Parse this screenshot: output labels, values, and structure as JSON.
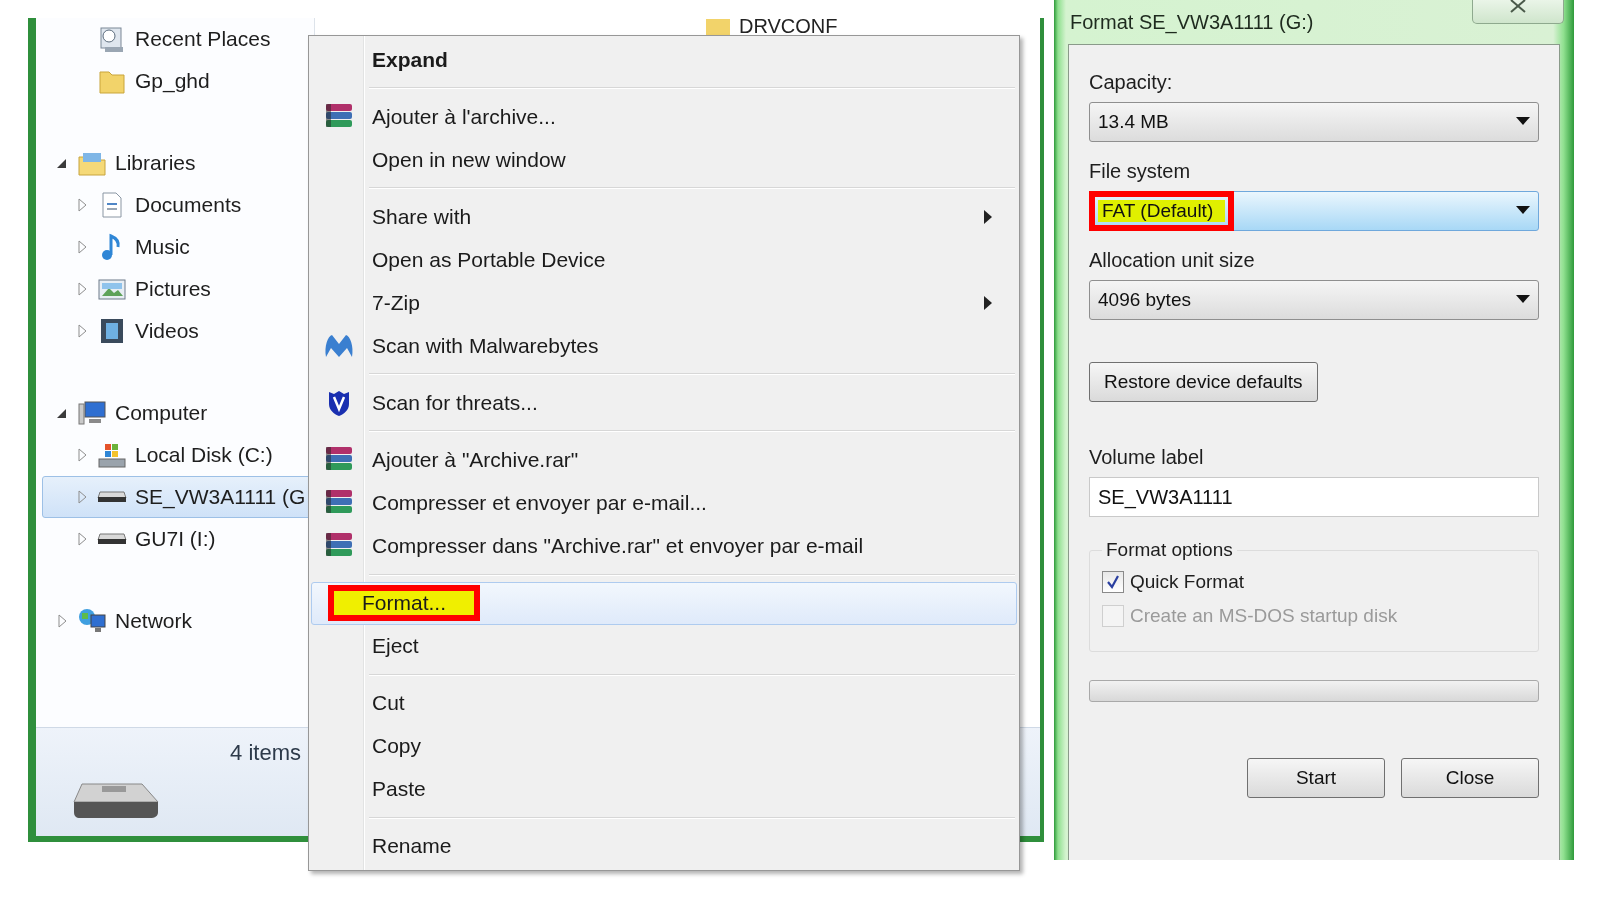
{
  "explorer": {
    "favorites": [
      {
        "label": "Recent Places",
        "kind": "recent"
      },
      {
        "label": "Gp_ghd",
        "kind": "folder"
      }
    ],
    "tree": [
      {
        "label": "Libraries",
        "kind": "library",
        "expanded": true,
        "selected": false,
        "children": [
          {
            "label": "Documents",
            "kind": "documents",
            "expanded": false,
            "selected": false
          },
          {
            "label": "Music",
            "kind": "music",
            "expanded": false,
            "selected": false
          },
          {
            "label": "Pictures",
            "kind": "pictures",
            "expanded": false,
            "selected": false
          },
          {
            "label": "Videos",
            "kind": "videos",
            "expanded": false,
            "selected": false
          }
        ]
      },
      {
        "label": "Computer",
        "kind": "computer",
        "expanded": true,
        "selected": false,
        "children": [
          {
            "label": "Local Disk (C:)",
            "kind": "disk",
            "expanded": false,
            "selected": false
          },
          {
            "label": "SE_VW3A1111 (G",
            "kind": "drive",
            "expanded": false,
            "selected": true
          },
          {
            "label": "GU7I (I:)",
            "kind": "drive",
            "expanded": false,
            "selected": false
          }
        ]
      },
      {
        "label": "Network",
        "kind": "network",
        "expanded": false,
        "selected": false
      }
    ],
    "content_item": "DRVCONF",
    "status": "4 items"
  },
  "context_menu": {
    "groups": [
      [
        {
          "label": "Expand",
          "kind": "plain",
          "bold": true,
          "submenu": false,
          "selected": false,
          "highlighted": false
        }
      ],
      [
        {
          "label": "Ajouter à l'archive...",
          "kind": "archive",
          "bold": false,
          "submenu": false,
          "selected": false,
          "highlighted": false
        },
        {
          "label": "Open in new window",
          "kind": "plain",
          "bold": false,
          "submenu": false,
          "selected": false,
          "highlighted": false
        }
      ],
      [
        {
          "label": "Share with",
          "kind": "plain",
          "bold": false,
          "submenu": true,
          "selected": false,
          "highlighted": false
        },
        {
          "label": "Open as Portable Device",
          "kind": "plain",
          "bold": false,
          "submenu": false,
          "selected": false,
          "highlighted": false
        },
        {
          "label": "7-Zip",
          "kind": "plain",
          "bold": false,
          "submenu": true,
          "selected": false,
          "highlighted": false
        },
        {
          "label": "Scan with Malwarebytes",
          "kind": "malware-scan",
          "bold": false,
          "submenu": false,
          "selected": false,
          "highlighted": false
        }
      ],
      [
        {
          "label": "Scan for threats...",
          "kind": "virus-scan",
          "bold": false,
          "submenu": false,
          "selected": false,
          "highlighted": false
        }
      ],
      [
        {
          "label": "Ajouter à \"Archive.rar\"",
          "kind": "archive",
          "bold": false,
          "submenu": false,
          "selected": false,
          "highlighted": false
        },
        {
          "label": "Compresser et envoyer par e-mail...",
          "kind": "archive",
          "bold": false,
          "submenu": false,
          "selected": false,
          "highlighted": false
        },
        {
          "label": "Compresser dans \"Archive.rar\" et envoyer par e-mail",
          "kind": "archive",
          "bold": false,
          "submenu": false,
          "selected": false,
          "highlighted": false
        }
      ],
      [
        {
          "label": "Format...",
          "kind": "plain",
          "bold": false,
          "submenu": false,
          "selected": true,
          "highlighted": true
        },
        {
          "label": "Eject",
          "kind": "plain",
          "bold": false,
          "submenu": false,
          "selected": false,
          "highlighted": false
        }
      ],
      [
        {
          "label": "Cut",
          "kind": "plain",
          "bold": false,
          "submenu": false,
          "selected": false,
          "highlighted": false
        },
        {
          "label": "Copy",
          "kind": "plain",
          "bold": false,
          "submenu": false,
          "selected": false,
          "highlighted": false
        },
        {
          "label": "Paste",
          "kind": "plain",
          "bold": false,
          "submenu": false,
          "selected": false,
          "highlighted": false
        }
      ],
      [
        {
          "label": "Rename",
          "kind": "plain",
          "bold": false,
          "submenu": false,
          "selected": false,
          "highlighted": false
        }
      ]
    ]
  },
  "format_dialog": {
    "title": "Format SE_VW3A1111 (G:)",
    "selects": [
      {
        "label": "Capacity:",
        "value": "13.4 MB",
        "focused": false,
        "highlighted": false
      },
      {
        "label": "File system",
        "value": "FAT (Default)",
        "focused": true,
        "highlighted": true
      },
      {
        "label": "Allocation unit size",
        "value": "4096 bytes",
        "focused": false,
        "highlighted": false
      }
    ],
    "restore_button": "Restore device defaults",
    "volume_label": {
      "label": "Volume label",
      "value": "SE_VW3A1111"
    },
    "format_options": {
      "title": "Format options",
      "options": [
        {
          "label": "Quick Format",
          "checked": true,
          "disabled": false
        },
        {
          "label": "Create an MS-DOS startup disk",
          "checked": false,
          "disabled": true
        }
      ]
    },
    "progress": {
      "level": 0
    },
    "buttons": [
      "Start",
      "Close"
    ]
  }
}
